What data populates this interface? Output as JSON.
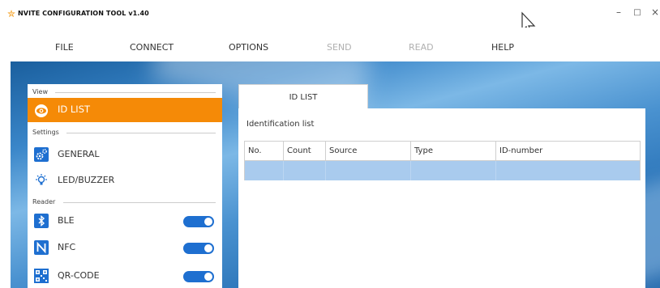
{
  "window": {
    "title": "NVITE CONFIGURATION TOOL v1.40",
    "minimize": "–",
    "maximize": "□",
    "close": "×"
  },
  "menu": [
    {
      "label": "FILE",
      "enabled": true
    },
    {
      "label": "CONNECT",
      "enabled": true
    },
    {
      "label": "OPTIONS",
      "enabled": true
    },
    {
      "label": "SEND",
      "enabled": false
    },
    {
      "label": "READ",
      "enabled": false
    },
    {
      "label": "HELP",
      "enabled": true
    }
  ],
  "sidebar": {
    "sections": {
      "view": "View",
      "settings": "Settings",
      "reader": "Reader"
    },
    "items": [
      {
        "label": "ID LIST",
        "icon": "eye-icon",
        "active": true
      },
      {
        "label": "GENERAL",
        "icon": "gears-icon",
        "active": false
      },
      {
        "label": "LED/BUZZER",
        "icon": "lightbulb-icon",
        "active": false
      },
      {
        "label": "BLE",
        "icon": "bluetooth-icon",
        "active": false,
        "toggle": true
      },
      {
        "label": "NFC",
        "icon": "nfc-icon",
        "active": false,
        "toggle": true
      },
      {
        "label": "QR-CODE",
        "icon": "qr-code-icon",
        "active": false,
        "toggle": true
      }
    ]
  },
  "main": {
    "tab": "ID LIST",
    "list_title": "Identification list",
    "columns": [
      "No.",
      "Count",
      "Source",
      "Type",
      "ID-number"
    ],
    "rows": [
      {
        "selected": true,
        "cells": [
          "",
          "",
          "",
          "",
          ""
        ]
      }
    ]
  },
  "colors": {
    "accent": "#f58a07",
    "toggle_on": "#1e6fd0",
    "selection": "#a9cbee"
  }
}
